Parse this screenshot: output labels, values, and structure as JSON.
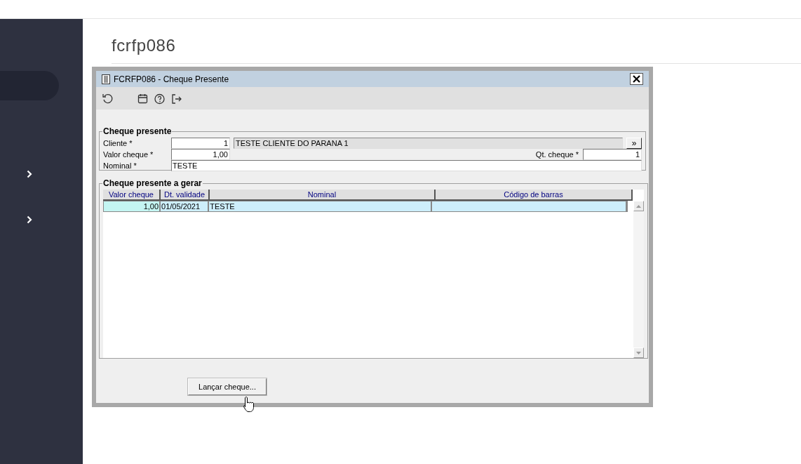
{
  "sidebar": {
    "items": [
      {
        "selected": true,
        "expandable": false
      },
      {
        "selected": false,
        "expandable": true
      },
      {
        "selected": false,
        "expandable": true
      }
    ]
  },
  "page": {
    "title": "fcrfp086"
  },
  "window": {
    "title": "FCRFP086 - Cheque Presente",
    "toolbar": [
      {
        "kind": "undo"
      },
      {
        "kind": "calendar"
      },
      {
        "kind": "help"
      },
      {
        "kind": "exit"
      }
    ]
  },
  "form": {
    "legend": "Cheque presente",
    "cliente": {
      "label": "Cliente *",
      "value": "1",
      "name": "TESTE CLIENTE DO PARANA 1",
      "lookup": "»"
    },
    "valor": {
      "label": "Valor cheque *",
      "value": "1,00"
    },
    "qt": {
      "label": "Qt. cheque *",
      "value": "1"
    },
    "nominal": {
      "label": "Nominal *",
      "value": "TESTE"
    }
  },
  "grid": {
    "legend": "Cheque presente a gerar",
    "columns": [
      "Valor cheque",
      "Dt. validade",
      "Nominal",
      "Código de barras"
    ],
    "rows": [
      {
        "selected": true,
        "cells": [
          "1,00",
          "01/05/2021",
          "TESTE",
          ""
        ]
      }
    ]
  },
  "buttons": [
    {
      "label": "Lançar cheque..."
    }
  ]
}
